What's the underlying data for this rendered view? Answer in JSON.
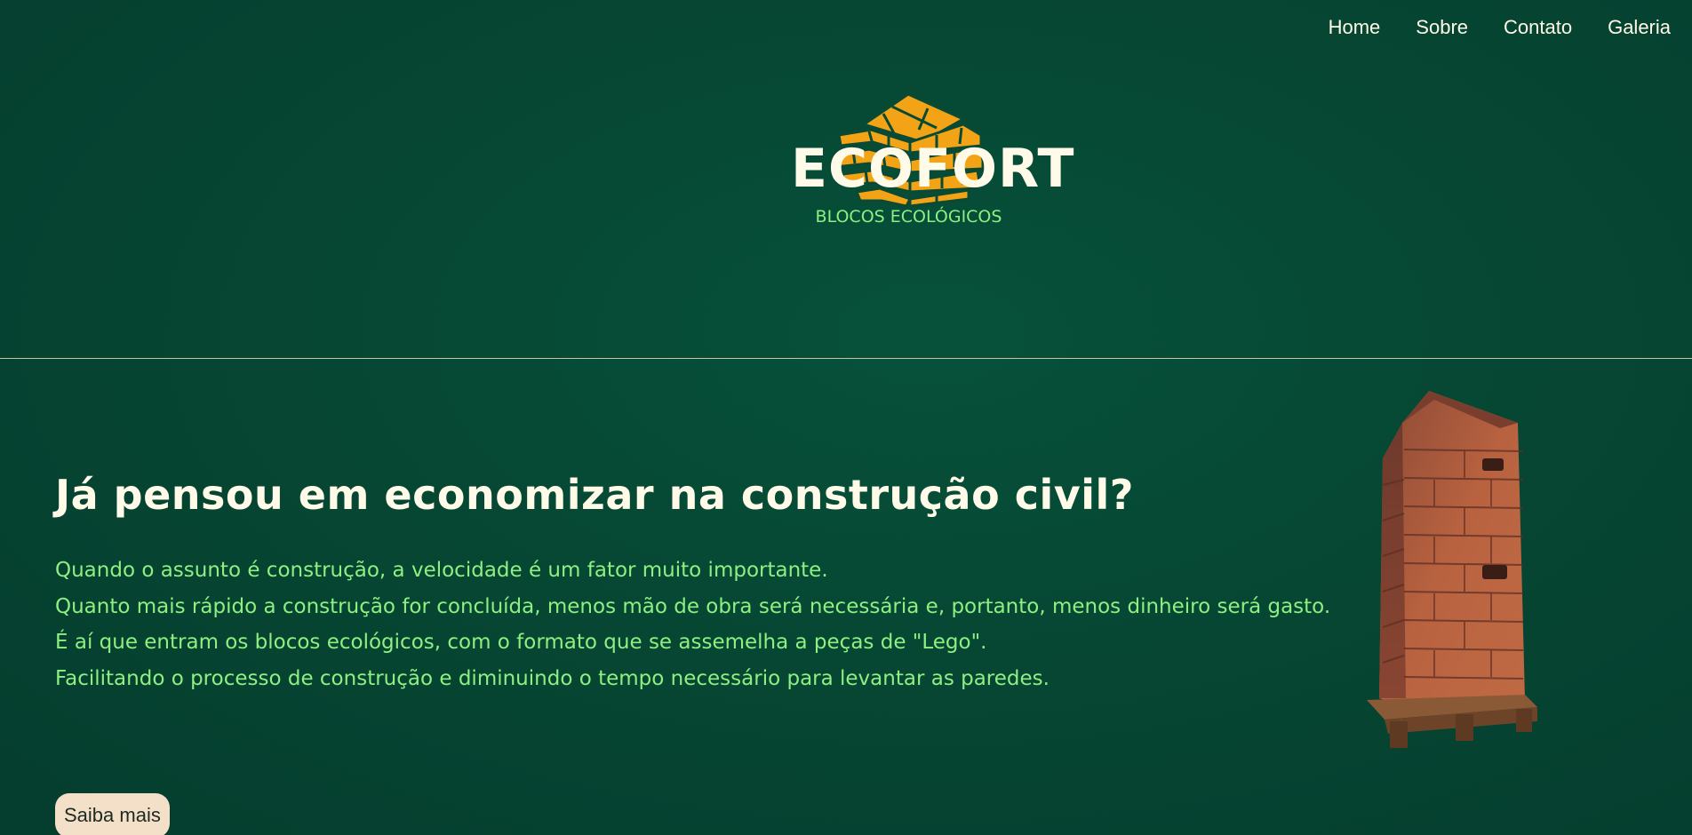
{
  "nav": {
    "items": [
      "Home",
      "Sobre",
      "Contato",
      "Galeria"
    ]
  },
  "brand": {
    "name": "ECOFORT",
    "subtitle": "BLOCOS ECOLÓGICOS",
    "logo_icon": "brick-wall-icon",
    "logo_color": "#f2a416"
  },
  "hero": {
    "headline": "Já pensou em economizar na construção civil?",
    "paragraphs": [
      "Quando o assunto é construção, a velocidade é um fator muito importante.",
      "Quanto mais rápido a construção for concluída, menos mão de obra será necessária e, portanto, menos dinheiro será gasto.",
      "É aí que entram os blocos ecológicos, com o formato que se assemelha a peças de \"Lego\".",
      "Facilitando o processo de construção e diminuindo o tempo necessário para levantar as paredes."
    ],
    "cta_label": "Saiba mais",
    "image_icon": "brick-pallet-image"
  },
  "colors": {
    "background": "#064733",
    "accent_green": "#8ff082",
    "cream": "#fffbe8",
    "button_bg": "#f4dfc8",
    "logo_orange": "#f2a416",
    "brick": "#b3603e"
  }
}
